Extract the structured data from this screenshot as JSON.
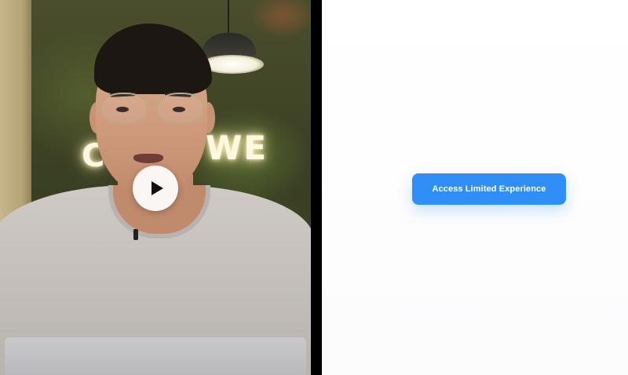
{
  "video": {
    "play_icon": "play-icon",
    "neon_sign": {
      "line1": "C",
      "line2": "WE"
    }
  },
  "cta": {
    "label": "Access Limited Experience",
    "color": "#2f8ff6",
    "text_color": "#ffffff"
  },
  "colors": {
    "divider": "#000000",
    "right_background": "#ffffff"
  }
}
